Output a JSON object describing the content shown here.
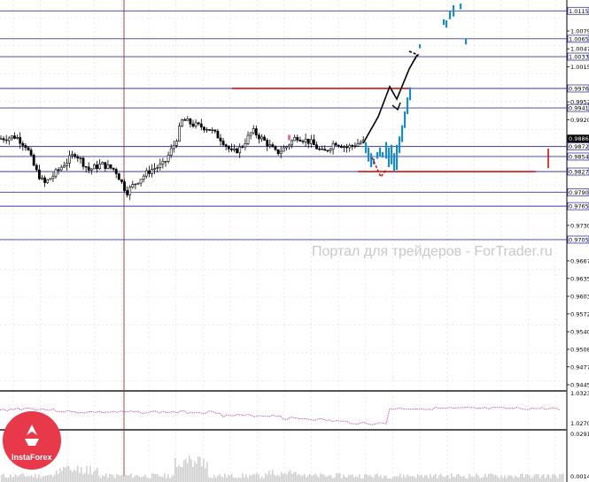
{
  "chart_data": [
    {
      "type": "candlestick",
      "title": "",
      "grid": true,
      "price_axis_ticks": [
        "1.00790",
        "1.00470",
        "1.00150",
        "0.99520",
        "0.99200",
        "0.97305",
        "0.96670",
        "0.96355",
        "0.96035",
        "0.95720",
        "0.95400",
        "0.95085",
        "0.94770",
        "0.94450"
      ],
      "levels": [
        {
          "value": "1.0115",
          "kind": "horizontal-line",
          "color": "#3a3aa0"
        },
        {
          "value": "1.0065",
          "kind": "horizontal-line",
          "color": "#3a3aa0"
        },
        {
          "value": "1.0033",
          "kind": "horizontal-line",
          "color": "#3a3aa0"
        },
        {
          "value": "0.9976",
          "kind": "horizontal-line",
          "color": "#3a3aa0"
        },
        {
          "value": "0.9941",
          "kind": "horizontal-line",
          "color": "#3a3aa0"
        },
        {
          "value": "0.98861",
          "kind": "current-price",
          "color": "#000000"
        },
        {
          "value": "0.9872",
          "kind": "horizontal-line",
          "color": "#3a3aa0"
        },
        {
          "value": "0.9854",
          "kind": "horizontal-line",
          "color": "#3a3aa0"
        },
        {
          "value": "0.9827",
          "kind": "horizontal-line",
          "color": "#3a3aa0"
        },
        {
          "value": "0.9790",
          "kind": "horizontal-line",
          "color": "#3a3aa0"
        },
        {
          "value": "0.9765",
          "kind": "horizontal-line",
          "color": "#3a3aa0"
        },
        {
          "value": "0.9705",
          "kind": "horizontal-line",
          "color": "#3a3aa0"
        }
      ],
      "resistance_segment_color": "#cc0000",
      "projection_color": "#1a8ac8",
      "arrow_up_color": "#000000",
      "arrow_down_color": "#cc0000"
    },
    {
      "type": "line",
      "title": "",
      "y_ticks": [
        "1.0323",
        "1.02709"
      ],
      "series_color": "#c050a8"
    },
    {
      "type": "bar",
      "title": "",
      "y_ticks": [
        "0.02913",
        "0.00141"
      ],
      "series_color": "#d0d0d0"
    }
  ],
  "watermark": "Портал для трейдеров - ForTrader.ru",
  "logo": {
    "label": "InstaForex",
    "color": "#e8394a"
  }
}
